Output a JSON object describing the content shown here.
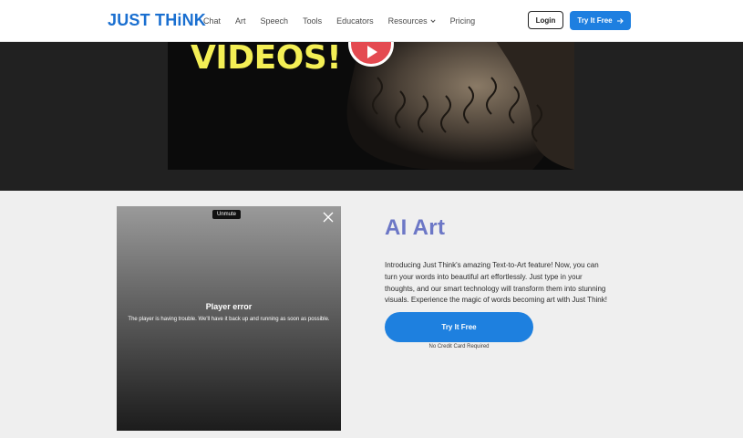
{
  "header": {
    "logo": "JUST THiNK",
    "nav": [
      "Chat",
      "Art",
      "Speech",
      "Tools",
      "Educators",
      "Resources",
      "Pricing"
    ],
    "login": "Login",
    "try_free": "Try It Free"
  },
  "hero": {
    "video_text": "VIDEOS!"
  },
  "player": {
    "unmute": "Unmute",
    "error_title": "Player error",
    "error_message": "The player is having trouble. We'll have it back up and running as soon as possible."
  },
  "feature": {
    "title": "AI Art",
    "description": "Introducing Just Think's amazing Text-to-Art feature! Now, you can turn your words into beautiful art effortlessly. Just type in your thoughts, and our smart technology will transform them into stunning visuals. Experience the magic of words becoming art with Just Think!",
    "cta": "Try It Free",
    "cta_note": "No Credit Card Required"
  },
  "colors": {
    "brand_blue": "#1e7fe0",
    "title_purple": "#6c77c6",
    "hero_bg": "#212121"
  }
}
